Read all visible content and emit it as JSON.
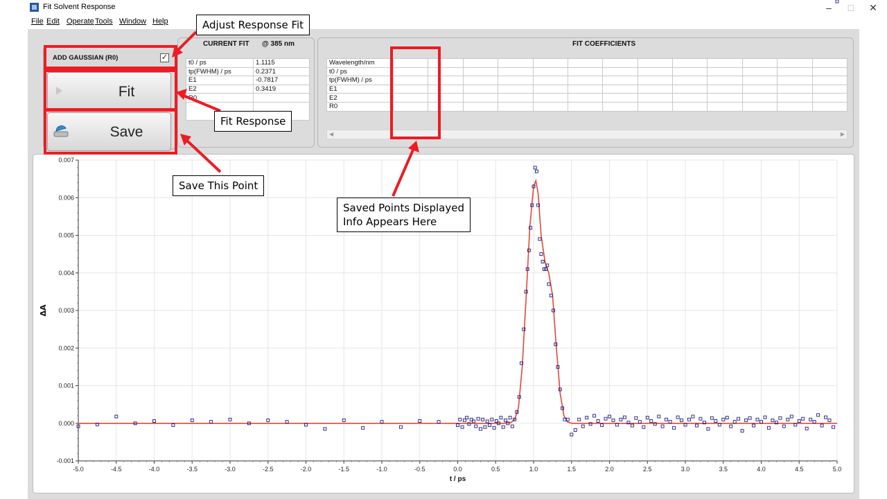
{
  "window": {
    "title": "Fit Solvent Response",
    "minimize_glyph": "–",
    "maximize_glyph": "□",
    "close_glyph": "✕"
  },
  "menu": [
    "File",
    "Edit",
    "Operate",
    "Tools",
    "Window",
    "Help"
  ],
  "controls": {
    "add_gaussian_label": "ADD GAUSSIAN (R0)",
    "add_gaussian_checked": true,
    "check_glyph": "✓",
    "fit_button": "Fit",
    "save_button": "Save"
  },
  "current_fit": {
    "title": "CURRENT FIT",
    "wavelength_label": "@ 385  nm",
    "rows": [
      {
        "label": "t0 / ps",
        "value": "1.1115"
      },
      {
        "label": "tp(FWHM) / ps",
        "value": "0.2371"
      },
      {
        "label": "E1",
        "value": "-0.7817"
      },
      {
        "label": "E2",
        "value": "0.3419"
      },
      {
        "label": "R0",
        "value": ""
      },
      {
        "label": "",
        "value": ""
      }
    ]
  },
  "fit_coefficients": {
    "title": "FIT COEFFICIENTS",
    "rows": [
      "Wavelength/nm",
      "t0 / ps",
      "tp(FWHM) / ps",
      "E1",
      "E2",
      "R0"
    ]
  },
  "callouts": {
    "adjust": "Adjust Response Fit",
    "fit": "Fit Response",
    "save": "Save This Point",
    "saved_line1": "Saved Points Displayed",
    "saved_line2": "Info Appears Here"
  },
  "colors": {
    "annotation_red": "#ec1c24",
    "fit_line": "#e2463a",
    "data_points": "#1a1a7a",
    "grid": "#e6e6e6"
  },
  "chart_data": {
    "type": "scatter",
    "xlabel": "t / ps",
    "ylabel": "ΔA",
    "xlim": [
      -5.0,
      5.0
    ],
    "ylim": [
      -0.001,
      0.007
    ],
    "xticks": [
      "-5.0",
      "-4.5",
      "-4.0",
      "-3.5",
      "-3.0",
      "-2.5",
      "-2.0",
      "-1.5",
      "-1.0",
      "-0.5",
      "0.0",
      "0.5",
      "1.0",
      "1.5",
      "2.0",
      "2.5",
      "3.0",
      "3.5",
      "4.0",
      "4.5",
      "5.0"
    ],
    "yticks": [
      "-0.001",
      "0.000",
      "0.001",
      "0.002",
      "0.003",
      "0.004",
      "0.005",
      "0.006",
      "0.007"
    ],
    "grid": true,
    "fit": {
      "x": [
        -5.0,
        0.6,
        0.7,
        0.75,
        0.8,
        0.85,
        0.9,
        0.95,
        1.0,
        1.03,
        1.06,
        1.1,
        1.15,
        1.2,
        1.25,
        1.3,
        1.35,
        1.4,
        1.45,
        1.5,
        5.0
      ],
      "y": [
        0.0,
        0.0,
        2e-05,
        0.0001,
        0.0004,
        0.0015,
        0.0033,
        0.0052,
        0.0063,
        0.00645,
        0.0061,
        0.005,
        0.0043,
        0.004,
        0.0034,
        0.002,
        0.0008,
        0.0002,
        3e-05,
        0.0,
        0.0
      ]
    },
    "points": {
      "x": [
        -5.0,
        -4.75,
        -4.5,
        -4.25,
        -4.0,
        -3.75,
        -3.5,
        -3.25,
        -3.0,
        -2.75,
        -2.5,
        -2.25,
        -2.0,
        -1.75,
        -1.5,
        -1.25,
        -1.0,
        -0.75,
        -0.5,
        -0.25,
        0.0,
        0.03,
        0.06,
        0.09,
        0.12,
        0.15,
        0.18,
        0.21,
        0.24,
        0.27,
        0.3,
        0.33,
        0.36,
        0.39,
        0.42,
        0.45,
        0.48,
        0.51,
        0.54,
        0.57,
        0.6,
        0.63,
        0.66,
        0.69,
        0.72,
        0.75,
        0.78,
        0.81,
        0.84,
        0.87,
        0.9,
        0.92,
        0.94,
        0.96,
        0.98,
        1.0,
        1.02,
        1.04,
        1.06,
        1.08,
        1.1,
        1.12,
        1.14,
        1.16,
        1.18,
        1.2,
        1.23,
        1.26,
        1.29,
        1.32,
        1.35,
        1.38,
        1.41,
        1.45,
        1.5,
        1.55,
        1.6,
        1.65,
        1.7,
        1.75,
        1.8,
        1.85,
        1.9,
        1.95,
        2.0,
        2.05,
        2.1,
        2.15,
        2.2,
        2.25,
        2.3,
        2.35,
        2.4,
        2.45,
        2.5,
        2.55,
        2.6,
        2.65,
        2.7,
        2.75,
        2.8,
        2.85,
        2.9,
        2.95,
        3.0,
        3.05,
        3.1,
        3.15,
        3.2,
        3.25,
        3.3,
        3.35,
        3.4,
        3.45,
        3.5,
        3.55,
        3.6,
        3.65,
        3.7,
        3.75,
        3.8,
        3.85,
        3.9,
        3.95,
        4.0,
        4.05,
        4.1,
        4.15,
        4.2,
        4.25,
        4.3,
        4.35,
        4.4,
        4.45,
        4.5,
        4.55,
        4.6,
        4.65,
        4.7,
        4.75,
        4.8,
        4.85,
        4.9,
        4.95,
        5.0
      ],
      "y": [
        -8e-05,
        -3e-05,
        0.00018,
        0.0,
        6e-05,
        -5e-05,
        8e-05,
        4e-05,
        0.0001,
        0.0,
        8e-05,
        4e-05,
        -4e-05,
        -0.00015,
        8e-05,
        -0.00012,
        4e-05,
        -0.0001,
        6e-05,
        4e-05,
        -5e-05,
        0.0001,
        -0.0001,
        8e-05,
        0.00015,
        -2e-05,
        0.0001,
        5e-05,
        -8e-05,
        0.00012,
        -0.00015,
        0.0001,
        -0.0001,
        5e-05,
        -5e-05,
        0.0001,
        -0.00012,
        6e-05,
        0.0,
        0.00015,
        -0.0001,
        8e-05,
        0.0,
        0.00015,
        -8e-05,
        0.0001,
        0.0003,
        0.0007,
        0.0016,
        0.0025,
        0.0035,
        0.0041,
        0.0046,
        0.0052,
        0.0058,
        0.0063,
        0.0068,
        0.0067,
        0.0058,
        0.0049,
        0.0045,
        0.0043,
        0.0041,
        0.0041,
        0.0042,
        0.0037,
        0.0034,
        0.003,
        0.0021,
        0.0015,
        0.0009,
        0.0004,
        0.0001,
        0.0001,
        -0.0003,
        -0.00018,
        0.0001,
        -8e-05,
        0.00015,
        -2e-05,
        0.0002,
        6e-05,
        -5e-05,
        0.00012,
        0.00018,
        8e-05,
        -4e-05,
        0.0001,
        0.00016,
        2e-05,
        -6e-05,
        0.00014,
        4e-05,
        -0.0001,
        0.00015,
        6e-05,
        -2e-05,
        0.00018,
        -8e-05,
        0.0001,
        4e-05,
        -0.00012,
        0.00016,
        8e-05,
        -4e-05,
        0.0001,
        0.00018,
        -6e-05,
        0.00012,
        2e-05,
        -0.00015,
        0.00014,
        6e-05,
        -4e-05,
        0.0001,
        0.00015,
        -8e-05,
        4e-05,
        0.00012,
        -0.0002,
        8e-05,
        0.00014,
        -6e-05,
        0.0001,
        4e-05,
        0.00016,
        -0.00012,
        8e-05,
        2e-05,
        0.00014,
        -8e-05,
        0.0001,
        0.00018,
        -4e-05,
        6e-05,
        0.00012,
        -0.00014,
        0.0001,
        4e-05,
        0.00022,
        -6e-05,
        0.00016,
        8e-05,
        -0.0001
      ]
    }
  }
}
